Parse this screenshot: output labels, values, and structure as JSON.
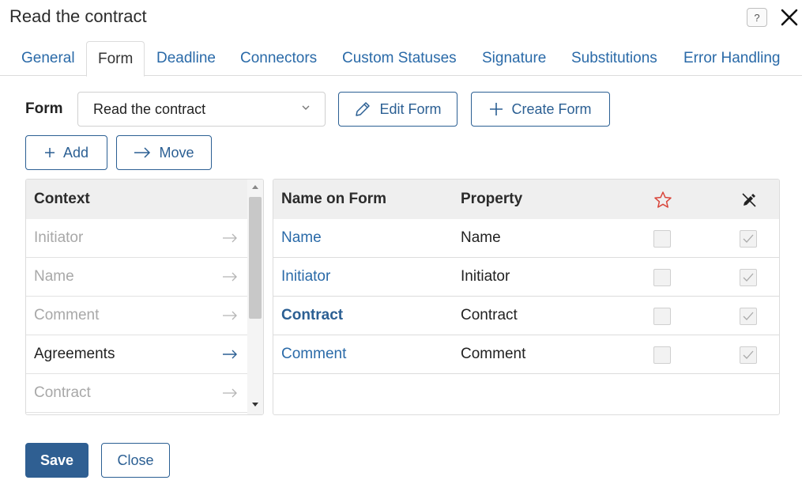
{
  "window": {
    "title": "Read the contract",
    "help_icon": "question-icon",
    "close_icon": "close-icon"
  },
  "tabs": [
    {
      "label": "General",
      "active": false
    },
    {
      "label": "Form",
      "active": true
    },
    {
      "label": "Deadline",
      "active": false
    },
    {
      "label": "Connectors",
      "active": false
    },
    {
      "label": "Custom Statuses",
      "active": false
    },
    {
      "label": "Signature",
      "active": false
    },
    {
      "label": "Substitutions",
      "active": false
    },
    {
      "label": "Error Handling",
      "active": false
    }
  ],
  "form": {
    "label": "Form",
    "selected": "Read the contract",
    "edit_label": "Edit Form",
    "create_label": "Create Form"
  },
  "toolbar": {
    "add_label": "Add",
    "move_label": "Move"
  },
  "context": {
    "header": "Context",
    "items": [
      {
        "label": "Initiator",
        "dimmed": true
      },
      {
        "label": "Name",
        "dimmed": true
      },
      {
        "label": "Comment",
        "dimmed": true
      },
      {
        "label": "Agreements",
        "dimmed": false
      },
      {
        "label": "Contract",
        "dimmed": true
      }
    ]
  },
  "grid": {
    "headers": {
      "name": "Name on Form",
      "property": "Property",
      "required_icon": "star-icon",
      "readonly_icon": "pen-crossed-icon"
    },
    "rows": [
      {
        "name": "Name",
        "property": "Name",
        "required": false,
        "readonly": true,
        "bold": false
      },
      {
        "name": "Initiator",
        "property": "Initiator",
        "required": false,
        "readonly": true,
        "bold": false
      },
      {
        "name": "Contract",
        "property": "Contract",
        "required": false,
        "readonly": true,
        "bold": true
      },
      {
        "name": "Comment",
        "property": "Comment",
        "required": false,
        "readonly": true,
        "bold": false
      }
    ]
  },
  "footer": {
    "save_label": "Save",
    "close_label": "Close"
  },
  "colors": {
    "accent": "#2b5f93",
    "link": "#2a6aa8",
    "star": "#d9453a"
  }
}
